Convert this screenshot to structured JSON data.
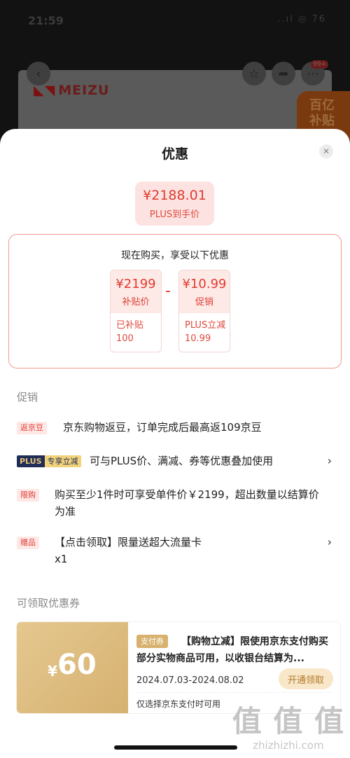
{
  "status": {
    "time": "21:59",
    "signals": "..ıl  ◎  76"
  },
  "background": {
    "logo": "MEIZU",
    "badge_line1": "百亿",
    "badge_line2": "补贴",
    "notify_count": "99+"
  },
  "sheet": {
    "title": "优惠",
    "final_price": {
      "value": "¥2188.01",
      "label": "PLUS到手价"
    },
    "summary": {
      "heading": "现在购买，享受以下优惠",
      "subsidy": {
        "value": "¥2199",
        "label": "补贴价",
        "detail_line1": "已补贴",
        "detail_line2": "100"
      },
      "operator": "-",
      "promo": {
        "value": "¥10.99",
        "label": "促销",
        "detail_line1": "PLUS立减",
        "detail_line2": "10.99"
      }
    },
    "promotions_title": "促销",
    "promotions": [
      {
        "tag": "返京豆",
        "text": "京东购物返豆，订单完成后最高返109京豆"
      },
      {
        "tag_a": "PLUS",
        "tag_b": "专享立减",
        "text": "可与PLUS价、满减、券等优惠叠加使用"
      },
      {
        "tag": "限购",
        "text": "购买至少1件时可享受单件价￥2199，超出数量以结算价为准"
      },
      {
        "tag": "赠品",
        "text": "【点击领取】限量送超大流量卡",
        "text2": "x1"
      }
    ],
    "coupons_title": "可领取优惠券",
    "coupon": {
      "currency": "¥",
      "amount": "60",
      "tag": "支付券",
      "description": "【购物立减】限使用京东支付购买部分实物商品可用，以收银台结算为...",
      "dates": "2024.07.03-2024.08.02",
      "button": "开通领取",
      "note": "仅选择京东支付时可用"
    }
  },
  "watermark": {
    "big": "值 值 值",
    "small": "zhizhizhi.com"
  }
}
